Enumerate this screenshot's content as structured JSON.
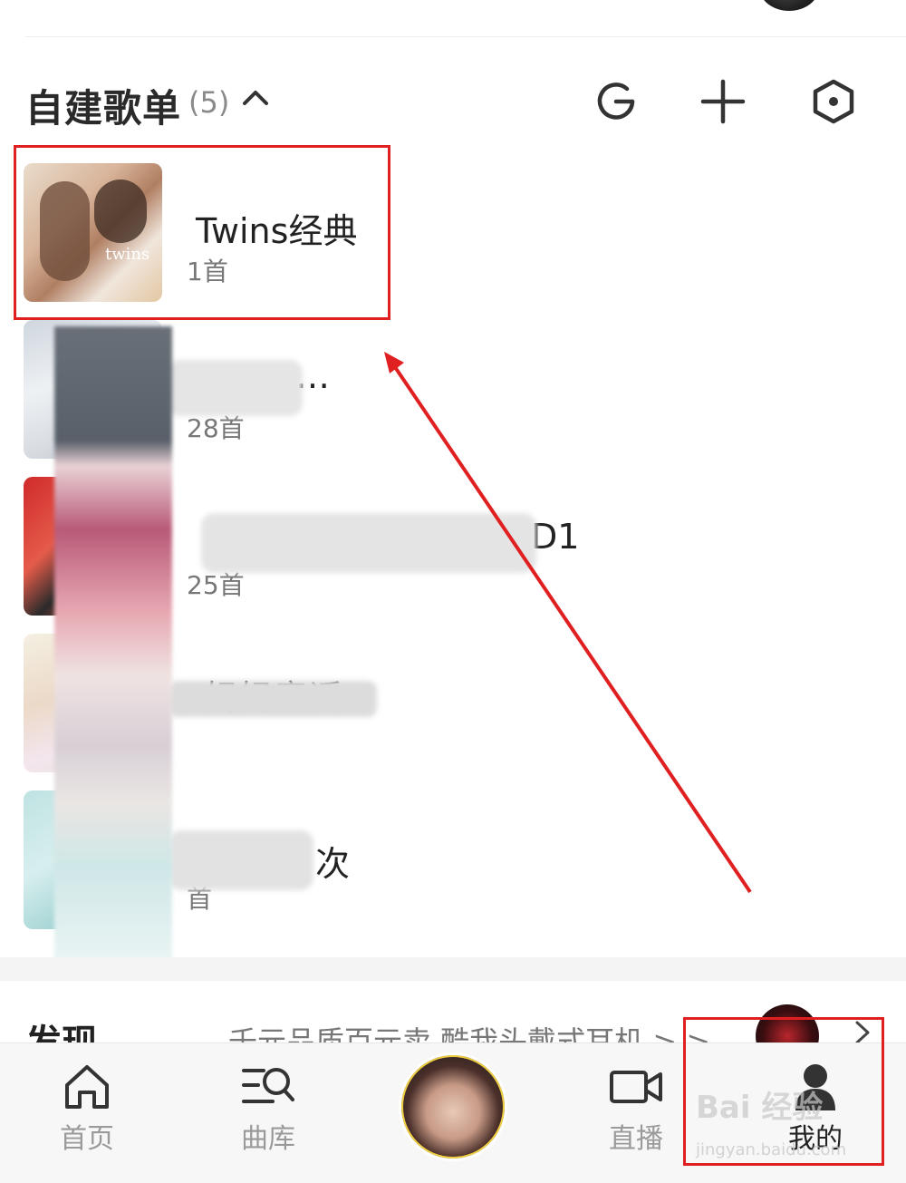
{
  "section": {
    "title": "自建歌单",
    "count": "(5)"
  },
  "playlists": [
    {
      "name": "Twins经典",
      "count": "1首"
    },
    {
      "name": "…",
      "count": "28首"
    },
    {
      "name": "D1",
      "count": "25首"
    },
    {
      "name": "妈妈童谣",
      "count": ""
    },
    {
      "name": "次",
      "count": "首"
    }
  ],
  "discover": {
    "title": "发现",
    "text": "千元品质百元卖   酷我头戴式耳机 > >"
  },
  "nav": {
    "home": "首页",
    "library": "曲库",
    "live": "直播",
    "mine": "我的"
  },
  "watermark": {
    "main": "Bai 经验",
    "sub": "jingyan.baidu.com"
  },
  "colors": {
    "annotation": "#e02020",
    "text_primary": "#222222",
    "text_secondary": "#777777"
  }
}
